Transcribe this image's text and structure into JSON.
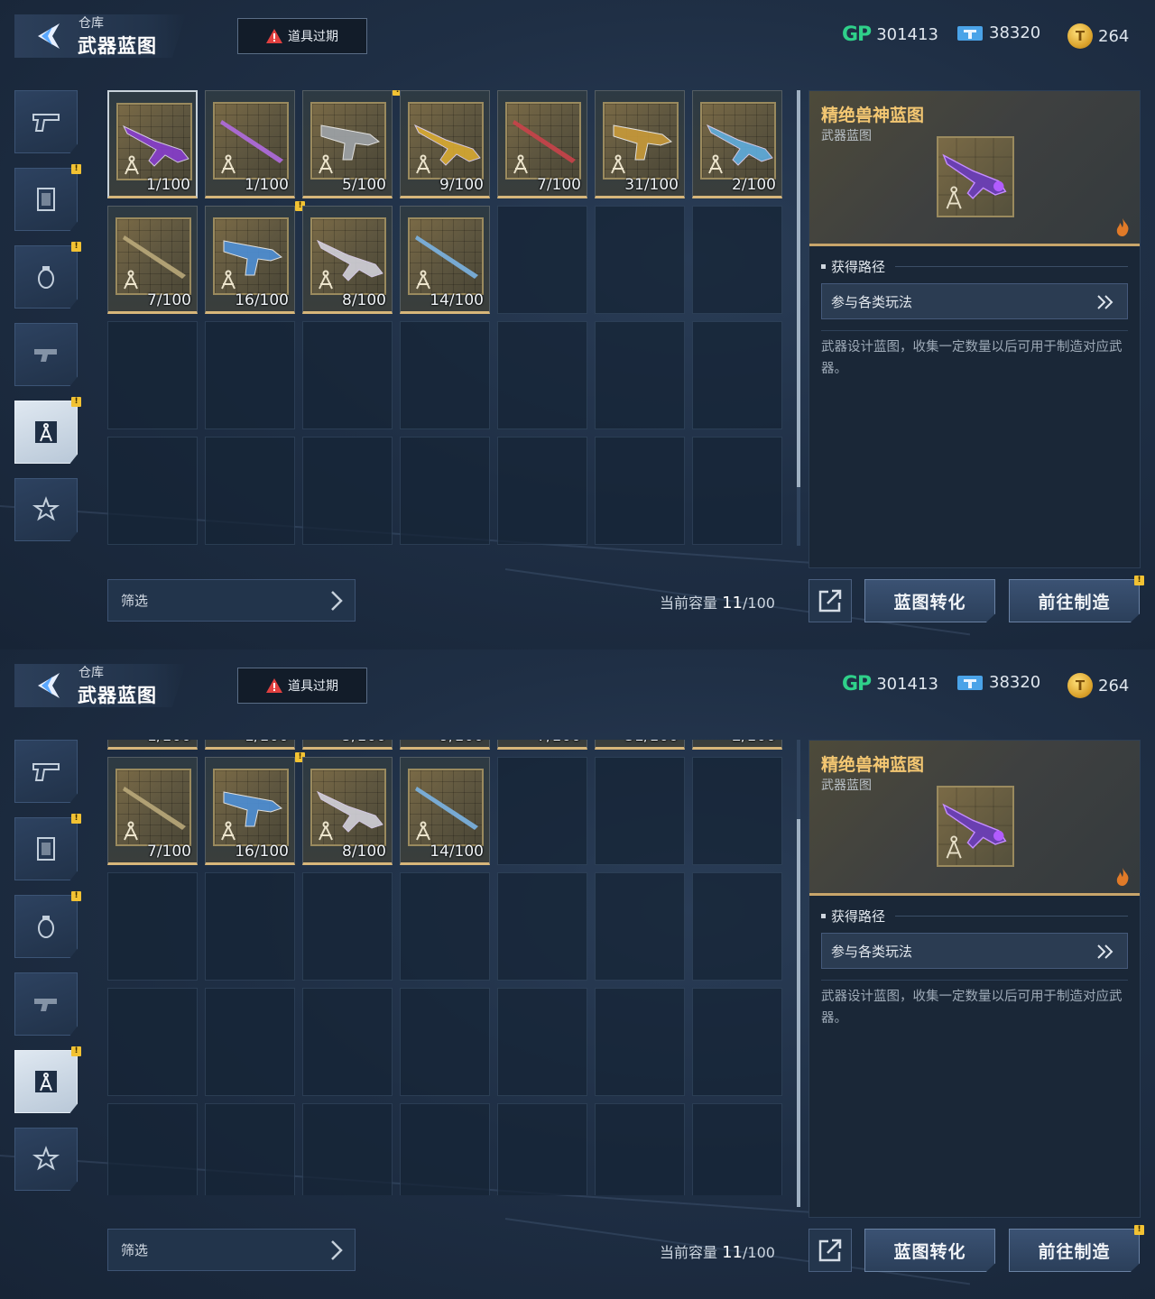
{
  "header": {
    "breadcrumb": "仓库",
    "title": "武器蓝图",
    "expire_button": "道具过期"
  },
  "currencies": {
    "gp": {
      "icon": "gp-icon",
      "label": "GP",
      "value": "301413"
    },
    "ticket": {
      "icon": "ticket-icon",
      "value": "38320"
    },
    "coin": {
      "icon": "coin-icon",
      "value": "264"
    }
  },
  "categories": [
    {
      "name": "pistol",
      "icon": "pistol-icon",
      "badge": false,
      "active": false
    },
    {
      "name": "armor-card",
      "icon": "card-icon",
      "badge": true,
      "active": false
    },
    {
      "name": "grenade",
      "icon": "grenade-icon",
      "badge": true,
      "active": false
    },
    {
      "name": "weapon-parts",
      "icon": "gun-parts-icon",
      "badge": false,
      "active": false
    },
    {
      "name": "blueprint",
      "icon": "compass-icon",
      "badge": true,
      "active": true
    },
    {
      "name": "favorite",
      "icon": "star-icon",
      "badge": false,
      "active": false
    }
  ],
  "items": [
    {
      "count": "1/100",
      "palette": "#8a3cd6",
      "selected": true,
      "badge": false
    },
    {
      "count": "1/100",
      "palette": "#b06be0",
      "selected": false,
      "badge": false
    },
    {
      "count": "5/100",
      "palette": "#9ea3a8",
      "selected": false,
      "badge": true
    },
    {
      "count": "9/100",
      "palette": "#e0b032",
      "selected": false,
      "badge": false
    },
    {
      "count": "7/100",
      "palette": "#c9424a",
      "selected": false,
      "badge": false
    },
    {
      "count": "31/100",
      "palette": "#c89a3a",
      "selected": false,
      "badge": false
    },
    {
      "count": "2/100",
      "palette": "#5fb3e8",
      "selected": false,
      "badge": false
    },
    {
      "count": "7/100",
      "palette": "#b9a87a",
      "selected": false,
      "badge": false
    },
    {
      "count": "16/100",
      "palette": "#4d8fd6",
      "selected": false,
      "badge": true
    },
    {
      "count": "8/100",
      "palette": "#d9d9e3",
      "selected": false,
      "badge": false
    },
    {
      "count": "14/100",
      "palette": "#7bb4e3",
      "selected": false,
      "badge": false
    }
  ],
  "bottom": {
    "filter_label": "筛选",
    "capacity_label": "当前容量",
    "capacity_current": "11",
    "capacity_total": "/100"
  },
  "detail": {
    "name": "精绝兽神蓝图",
    "type": "武器蓝图",
    "source_title": "获得路径",
    "source_button": "参与各类玩法",
    "description": "武器设计蓝图，收集一定数量以后可用于制造对应武器。"
  },
  "actions": {
    "convert": "蓝图转化",
    "craft": "前往制造"
  },
  "colors": {
    "accent_gold": "#f4c772",
    "badge_yellow": "#f2c233",
    "gp_green": "#2fd08a"
  }
}
